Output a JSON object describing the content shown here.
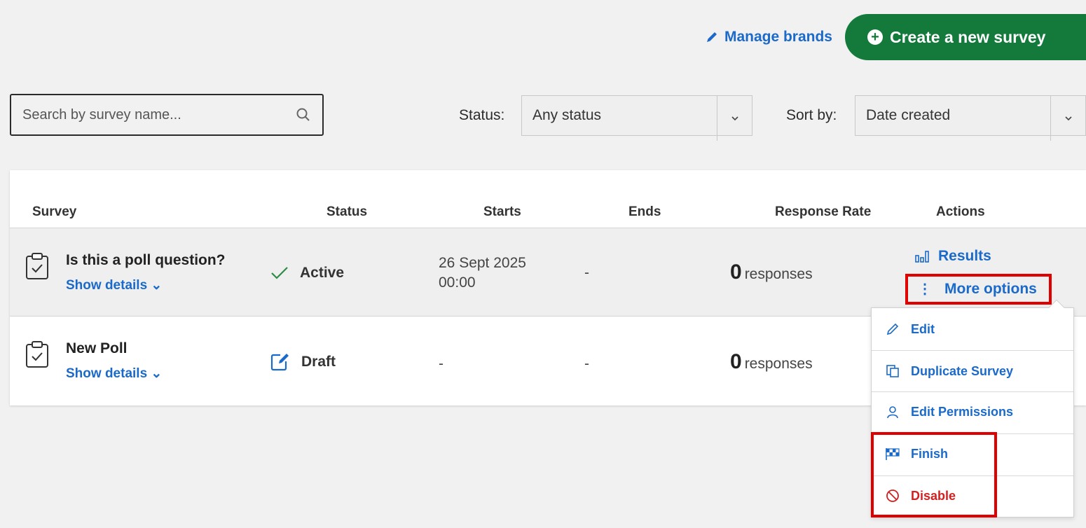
{
  "header": {
    "manage_brands_label": "Manage brands",
    "create_survey_label": "Create a new survey"
  },
  "filters": {
    "search_placeholder": "Search by survey name...",
    "status_label": "Status:",
    "status_value": "Any status",
    "sort_label": "Sort by:",
    "sort_value": "Date created"
  },
  "table": {
    "columns": [
      "Survey",
      "Status",
      "Starts",
      "Ends",
      "Response Rate",
      "Actions"
    ],
    "rows": [
      {
        "title": "Is this a poll question?",
        "details_label": "Show details ⌄",
        "status": "Active",
        "starts_date": "26 Sept 2025",
        "starts_time": "00:00",
        "ends": "-",
        "responses_count": "0",
        "responses_label": "responses"
      },
      {
        "title": "New Poll",
        "details_label": "Show details ⌄",
        "status": "Draft",
        "starts_date": "-",
        "starts_time": "",
        "ends": "-",
        "responses_count": "0",
        "responses_label": "responses"
      }
    ],
    "actions": {
      "results_label": "Results",
      "more_options_label": "More options"
    }
  },
  "menu": {
    "items": [
      {
        "label": "Edit",
        "icon": "pencil-icon"
      },
      {
        "label": "Duplicate Survey",
        "icon": "copy-icon"
      },
      {
        "label": "Edit Permissions",
        "icon": "user-icon"
      },
      {
        "label": "Finish",
        "icon": "checkered-flag-icon"
      },
      {
        "label": "Disable",
        "icon": "prohibited-icon"
      }
    ]
  },
  "colors": {
    "link": "#1b6ac9",
    "primary_green": "#137a3c",
    "danger": "#d32020",
    "highlight": "#e00000"
  }
}
